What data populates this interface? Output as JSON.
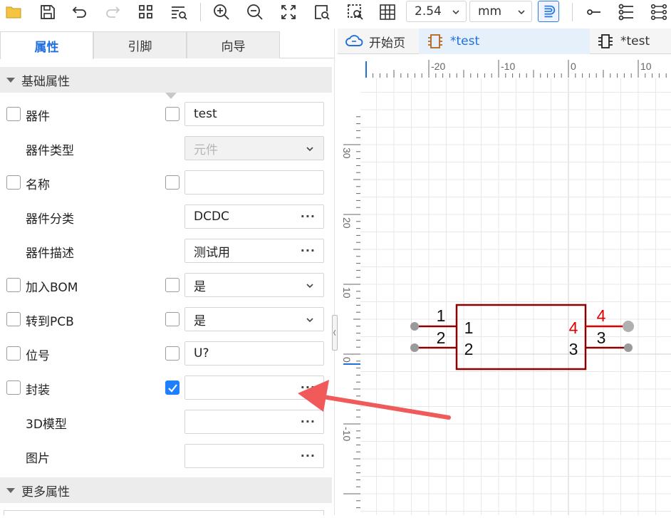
{
  "toolbar": {
    "zoom_value": "2.54",
    "unit_value": "mm",
    "icons": [
      "folder-icon",
      "save-icon",
      "undo-icon",
      "redo-icon",
      "grid-layout-icon",
      "list-search-icon",
      "zoom-in-icon",
      "zoom-out-icon",
      "fit-view-icon",
      "zoom-area-icon",
      "select-area-icon",
      "grid-icon",
      "magnet-icon",
      "pin-icon",
      "pin-list-icon",
      "pin-array-icon"
    ]
  },
  "left_panel": {
    "tabs": [
      {
        "label": "属性",
        "active": true
      },
      {
        "label": "引脚",
        "active": false
      },
      {
        "label": "向导",
        "active": false
      }
    ],
    "sections": [
      {
        "label": "基础属性",
        "expanded": true
      },
      {
        "label": "更多属性",
        "expanded": true
      }
    ],
    "properties": [
      {
        "name": "器件",
        "value": "test",
        "checkbox": true,
        "value_checkbox": true,
        "value_checked": false,
        "type": "text"
      },
      {
        "name": "器件类型",
        "value": "元件",
        "checkbox": false,
        "value_checkbox": false,
        "type": "select-disabled"
      },
      {
        "name": "名称",
        "value": "",
        "checkbox": true,
        "value_checkbox": true,
        "value_checked": false,
        "type": "text"
      },
      {
        "name": "器件分类",
        "value": "DCDC",
        "checkbox": false,
        "value_checkbox": false,
        "type": "more"
      },
      {
        "name": "器件描述",
        "value": "测试用",
        "checkbox": false,
        "value_checkbox": false,
        "type": "more"
      },
      {
        "name": "加入BOM",
        "value": "是",
        "checkbox": true,
        "value_checkbox": true,
        "value_checked": false,
        "type": "select"
      },
      {
        "name": "转到PCB",
        "value": "是",
        "checkbox": true,
        "value_checkbox": true,
        "value_checked": false,
        "type": "select"
      },
      {
        "name": "位号",
        "value": "U?",
        "checkbox": true,
        "value_checkbox": true,
        "value_checked": false,
        "type": "text"
      },
      {
        "name": "封装",
        "value": "",
        "checkbox": true,
        "value_checkbox": true,
        "value_checked": true,
        "type": "more"
      },
      {
        "name": "3D模型",
        "value": "",
        "checkbox": false,
        "value_checkbox": false,
        "type": "more"
      },
      {
        "name": "图片",
        "value": "",
        "checkbox": false,
        "value_checkbox": false,
        "type": "more"
      }
    ],
    "more_button": "···"
  },
  "doc_tabs": [
    {
      "label": "开始页",
      "icon": "cloud-icon",
      "active": false
    },
    {
      "label": "*test",
      "icon": "chip-icon",
      "active": true
    },
    {
      "label": "*test",
      "icon": "symbol-icon",
      "active": false
    }
  ],
  "canvas": {
    "ruler_h_labels": [
      "-20",
      "-10",
      "0",
      "10"
    ],
    "ruler_v_labels": [
      "30",
      "20",
      "10",
      "0",
      "-10"
    ],
    "component": {
      "pins_left": [
        {
          "outer": "1",
          "inner": "1"
        },
        {
          "outer": "2",
          "inner": "2"
        }
      ],
      "pins_right": [
        {
          "outer": "4",
          "inner": "4",
          "highlighted": true
        },
        {
          "outer": "3",
          "inner": "3",
          "highlighted": false
        }
      ]
    },
    "colors": {
      "component": "#8b0000",
      "highlight": "#e00000",
      "grid": "#e8e8e8",
      "arrow": "#f05a5a"
    }
  }
}
